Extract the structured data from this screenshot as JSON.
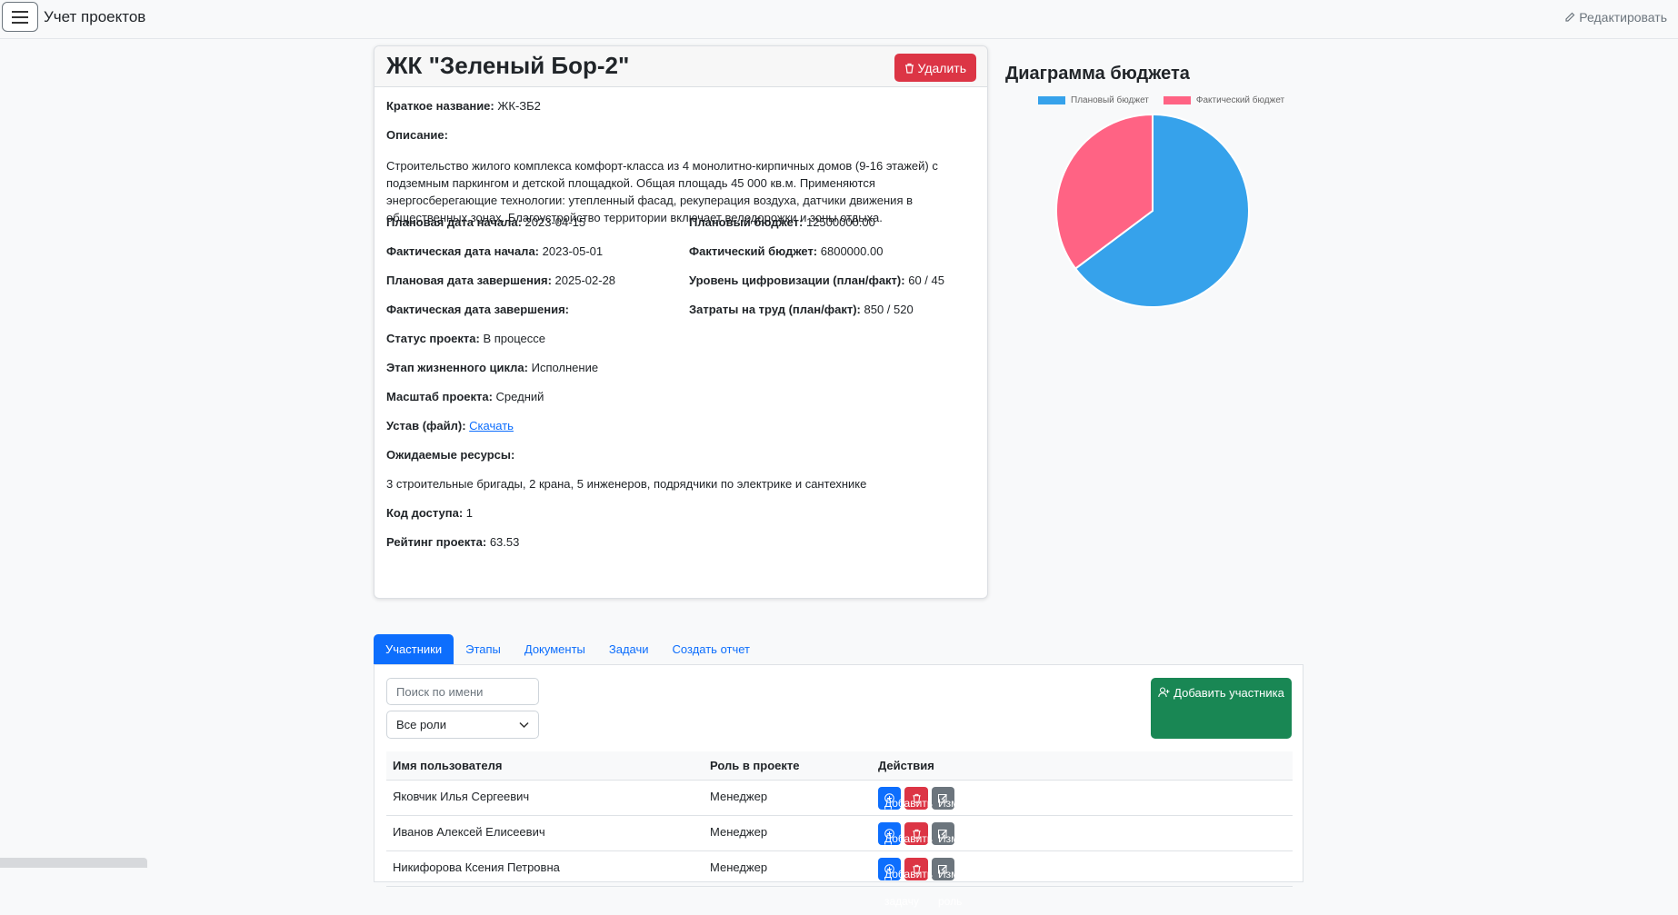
{
  "nav": {
    "title": "Учет проектов",
    "edit_label": "Редактировать"
  },
  "project": {
    "title": "ЖК \"Зеленый Бор-2\"",
    "delete_label": "Удалить",
    "short_name_label": "Краткое название:",
    "short_name": "ЖК-ЗБ2",
    "description_label": "Описание:",
    "description": "Строительство жилого комплекса комфорт-класса из 4 монолитно-кирпичных домов (9-16 этажей) с подземным паркингом и детской площадкой. Общая площадь 45 000 кв.м. Применяются энергосберегающие технологии: утепленный фасад, рекуперация воздуха, датчики движения в общественных зонах. Благоустройство территории включает велодорожки и зоны отдыха.",
    "planned_start_label": "Плановая дата начала:",
    "planned_start": "2023-04-15",
    "actual_start_label": "Фактическая дата начала:",
    "actual_start": "2023-05-01",
    "planned_end_label": "Плановая дата завершения:",
    "planned_end": "2025-02-28",
    "actual_end_label": "Фактическая дата завершения:",
    "actual_end": "",
    "planned_budget_label": "Плановый бюджет:",
    "planned_budget": "12500000.00",
    "actual_budget_label": "Фактический бюджет:",
    "actual_budget": "6800000.00",
    "digital_label": "Уровень цифровизации (план/факт):",
    "digital": "60 / 45",
    "labor_label": "Затраты на труд (план/факт):",
    "labor": "850 / 520",
    "status_label": "Статус проекта:",
    "status": "В процессе",
    "stage_label": "Этап жизненного цикла:",
    "stage": "Исполнение",
    "scale_label": "Масштаб проекта:",
    "scale": "Средний",
    "charter_label": "Устав (файл):",
    "charter_link": "Скачать",
    "resources_label": "Ожидаемые ресурсы:",
    "resources": "3 строительные бригады, 2 крана, 5 инженеров, подрядчики по электрике и сантехнике",
    "access_code_label": "Код доступа:",
    "access_code": "1",
    "rating_label": "Рейтинг проекта:",
    "rating": "63.53"
  },
  "chart_heading": "Диаграмма бюджета",
  "chart_data": {
    "type": "pie",
    "title": "",
    "labels": [
      "Плановый бюджет",
      "Фактический бюджет"
    ],
    "values": [
      12500000,
      6800000
    ],
    "colors": [
      "#36a2eb",
      "#ff6384"
    ],
    "legend": "top"
  },
  "tabs": [
    "Участники",
    "Этапы",
    "Документы",
    "Задачи",
    "Создать отчет"
  ],
  "members": {
    "search_placeholder": "Поиск по имени",
    "role_filter": "Все роли",
    "add_label": "Добавить участника",
    "headers": [
      "Имя пользователя",
      "Роль в проекте",
      "Действия"
    ],
    "add_task_label": "Добавить задачу",
    "change_role_label": "Изменить роль",
    "rows": [
      {
        "name": "Яковчик Илья Сергеевич",
        "role": "Менеджер"
      },
      {
        "name": "Иванов Алексей Елисеевич",
        "role": "Менеджер"
      },
      {
        "name": "Никифорова Ксения Петровна",
        "role": "Менеджер"
      }
    ]
  }
}
